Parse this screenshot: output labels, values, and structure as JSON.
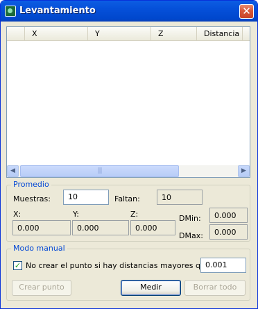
{
  "window": {
    "title": "Levantamiento",
    "close_glyph": "✕"
  },
  "table": {
    "columns": [
      "",
      "X",
      "Y",
      "Z",
      "Distancia"
    ],
    "rows": [],
    "scroll_left_glyph": "◀",
    "scroll_right_glyph": "▶",
    "thumb_grip": "|||"
  },
  "promedio": {
    "title": "Promedio",
    "muestras_label": "Muestras:",
    "muestras_value": "10",
    "faltan_label": "Faltan:",
    "faltan_value": "10",
    "x_label": "X:",
    "y_label": "Y:",
    "z_label": "Z:",
    "x_value": "0.000",
    "y_value": "0.000",
    "z_value": "0.000",
    "dmin_label": "DMin:",
    "dmin_value": "0.000",
    "dmax_label": "DMax:",
    "dmax_value": "0.000"
  },
  "modo_manual": {
    "title": "Modo manual",
    "checkbox_checked": true,
    "checkbox_glyph": "✓",
    "checkbox_label": "No crear el punto si hay distancias mayores que:",
    "threshold_value": "0.001"
  },
  "buttons": {
    "crear_punto": "Crear punto",
    "medir": "Medir",
    "borrar_todo": "Borrar todo"
  }
}
